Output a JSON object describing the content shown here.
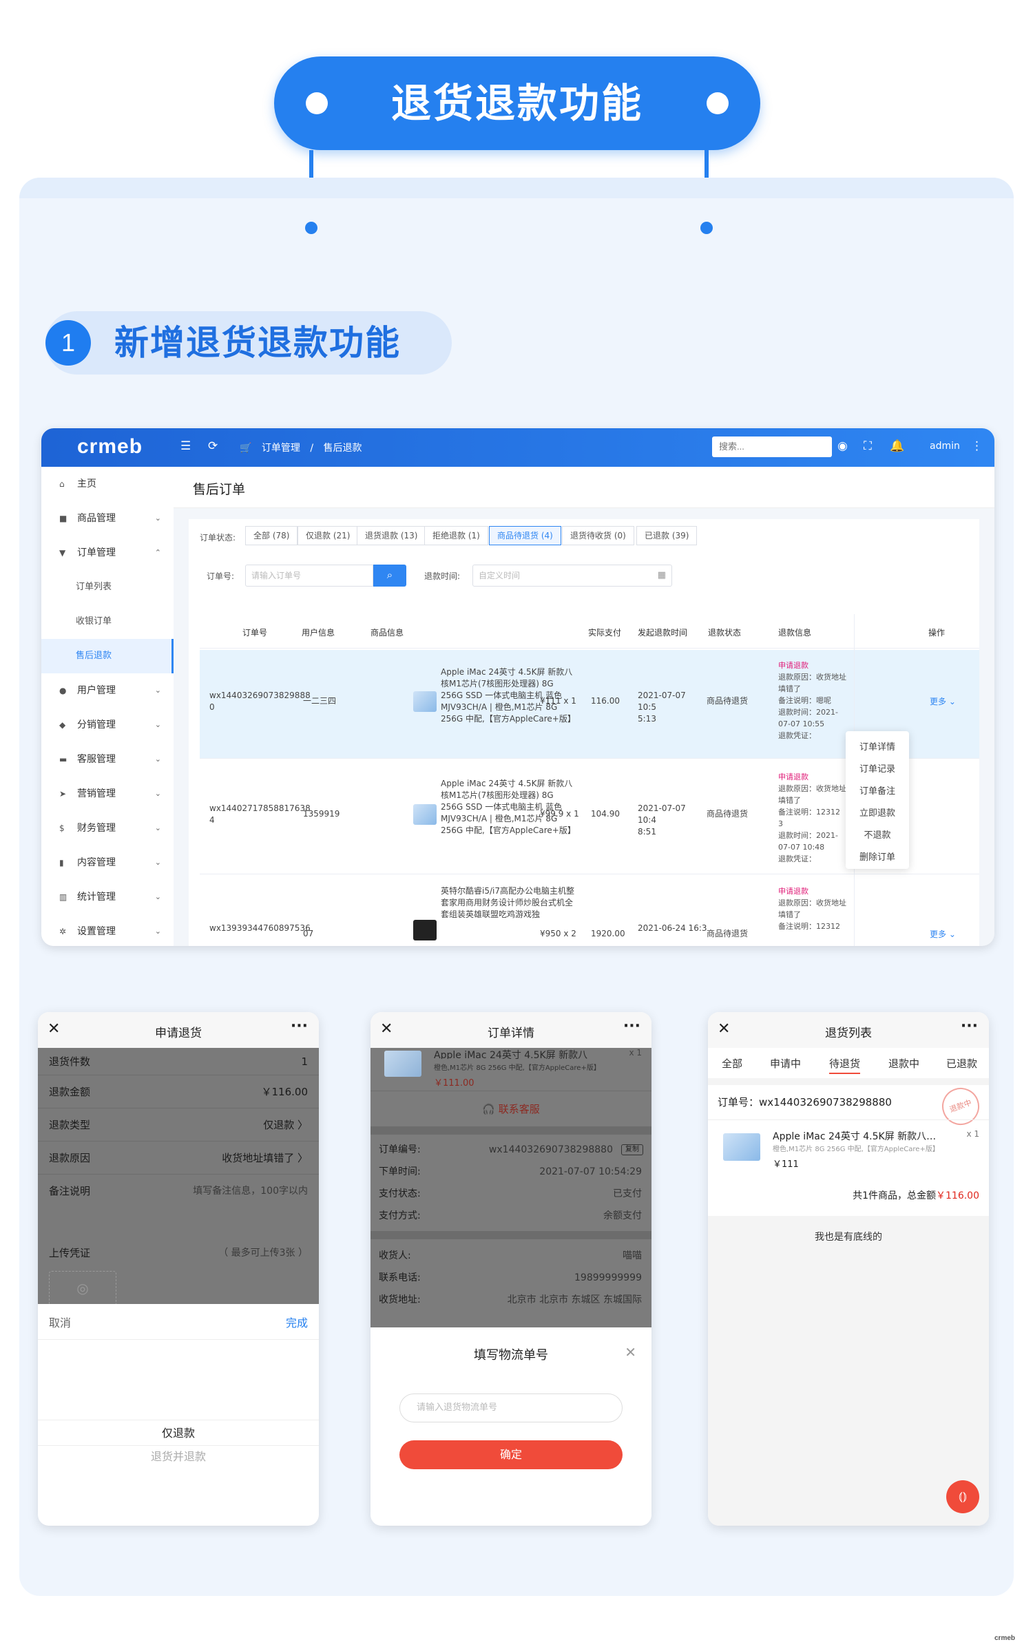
{
  "hero": {
    "title": "退货退款功能"
  },
  "section": {
    "number": "1",
    "title": "新增退货退款功能"
  },
  "admin": {
    "logo": "crmeb",
    "breadcrumb": [
      "订单管理",
      "/",
      "售后退款"
    ],
    "search_placeholder": "搜索...",
    "user": "admin",
    "sidebar": [
      {
        "label": "主页",
        "icon": "home-icon",
        "arrow": ""
      },
      {
        "label": "商品管理",
        "icon": "shop-icon",
        "arrow": "⌄"
      },
      {
        "label": "订单管理",
        "icon": "cart-icon",
        "arrow": "⌃"
      },
      {
        "label": "用户管理",
        "icon": "user-icon",
        "arrow": "⌄"
      },
      {
        "label": "分销管理",
        "icon": "share-icon",
        "arrow": "⌄"
      },
      {
        "label": "客服管理",
        "icon": "chat-icon",
        "arrow": "⌄"
      },
      {
        "label": "营销管理",
        "icon": "send-icon",
        "arrow": "⌄"
      },
      {
        "label": "财务管理",
        "icon": "dollar-icon",
        "arrow": "⌄"
      },
      {
        "label": "内容管理",
        "icon": "book-icon",
        "arrow": "⌄"
      },
      {
        "label": "统计管理",
        "icon": "bar-chart-icon",
        "arrow": "⌄"
      },
      {
        "label": "设置管理",
        "icon": "gear-icon",
        "arrow": "⌄"
      }
    ],
    "sub_items": [
      "订单列表",
      "收银订单",
      "售后退款"
    ],
    "page_title": "售后订单",
    "status_label": "订单状态:",
    "status_tabs": [
      "全部 (78)",
      "仅退款 (21)",
      "退货退款 (13)",
      "拒绝退款 (1)",
      "商品待退货 (4)",
      "退货待收货 (0)",
      "已退款 (39)"
    ],
    "order_label": "订单号:",
    "order_placeholder": "请输入订单号",
    "date_label": "退款时间:",
    "date_placeholder": "自定义时间",
    "columns": [
      "订单号",
      "用户信息",
      "商品信息",
      "实际支付",
      "发起退款时间",
      "退款状态",
      "退款信息",
      "操作"
    ],
    "rows": [
      {
        "order_no": "wx14403269073829888\n0",
        "user": "一二三四",
        "product": "Apple iMac 24英寸 4.5K屏 新款八核M1芯片(7核图形处理器) 8G 256G SSD 一体式电脑主机 蓝色 MJV93CH/A | 橙色,M1芯片 8G 256G 中配,【官方AppleCare+版】",
        "qty": "¥111 x 1",
        "paid": "116.00",
        "time": "2021-07-07 10:5\n5:13",
        "status": "商品待退货",
        "refund_state": "申请退款",
        "refund_info": "退款原因：收货地址填错了\n备注说明：嗯呢\n退款时间：2021-07-07 10:55\n退款凭证：",
        "more": "更多 ⌄"
      },
      {
        "order_no": "wx14402717858817638\n4",
        "user": "1359919",
        "product": "Apple iMac 24英寸 4.5K屏 新款八核M1芯片(7核图形处理器) 8G 256G SSD 一体式电脑主机 蓝色 MJV93CH/A | 橙色,M1芯片 8G 256G 中配,【官方AppleCare+版】",
        "qty": "¥99.9 x 1",
        "paid": "104.90",
        "time": "2021-07-07 10:4\n8:51",
        "status": "商品待退货",
        "refund_state": "申请退款",
        "refund_info": "退款原因：收货地址填错了\n备注说明：12312\n3\n退款时间：2021-07-07 10:48\n退款凭证：",
        "more": ""
      },
      {
        "order_no": "wx13939344760897536",
        "user": "07",
        "product": "英特尔酷睿i5/i7高配办公电脑主机整套家用商用财务设计师炒股台式机全套组装英雄联盟吃鸡游戏独",
        "qty": "¥950 x 2",
        "paid": "1920.00",
        "time": "2021-06-24 16:3",
        "status": "商品待退货",
        "refund_state": "申请退款",
        "refund_info": "退款原因：收货地址填错了\n备注说明：12312",
        "more": "更多 ⌄"
      }
    ],
    "dropdown": [
      "订单详情",
      "订单记录",
      "订单备注",
      "立即退款",
      "不退款",
      "删除订单"
    ]
  },
  "phone1": {
    "title": "申请退货",
    "fields": [
      {
        "k": "退货件数",
        "v": "1"
      },
      {
        "k": "退款金额",
        "v": "￥116.00"
      },
      {
        "k": "退款类型",
        "v": "仅退款  〉"
      },
      {
        "k": "退款原因",
        "v": "收货地址填错了  〉"
      },
      {
        "k": "备注说明",
        "v": "填写备注信息，100字以内"
      }
    ],
    "upload_label": "上传凭证",
    "upload_hint": "（ 最多可上传3张 ）",
    "cancel": "取消",
    "done": "完成",
    "options": [
      "仅退款",
      "退货并退款"
    ]
  },
  "phone2": {
    "title": "订单详情",
    "product_title": "Apple iMac 24英寸 4.5K屏 新款八",
    "product_spec": "橙色,M1芯片 8G 256G 中配,【官方AppleCare+版】",
    "qty": "x 1",
    "price": "￥111.00",
    "service": "联系客服",
    "details": [
      {
        "k": "订单编号:",
        "v": "wx144032690738298880"
      },
      {
        "k": "下单时间:",
        "v": "2021-07-07 10:54:29"
      },
      {
        "k": "支付状态:",
        "v": "已支付"
      },
      {
        "k": "支付方式:",
        "v": "余额支付"
      }
    ],
    "copy": "复制",
    "address": [
      {
        "k": "收货人:",
        "v": "喵喵"
      },
      {
        "k": "联系电话:",
        "v": "19899999999"
      },
      {
        "k": "收货地址:",
        "v": "北京市 北京市 东城区 东城国际"
      }
    ],
    "sheet_title": "填写物流单号",
    "input_placeholder": "请输入退货物流单号",
    "confirm": "确定"
  },
  "phone3": {
    "title": "退货列表",
    "tabs": [
      "全部",
      "申请中",
      "待退货",
      "退款中",
      "已退款"
    ],
    "order_label": "订单号：wx144032690738298880",
    "stamp": "退款中",
    "product_title": "Apple iMac 24英寸 4.5K屏 新款八…",
    "product_spec": "橙色,M1芯片 8G 256G 中配,【官方AppleCare+版】",
    "qty": "x 1",
    "price": "￥111",
    "summary": "共1件商品，总金额",
    "total": "￥116.00",
    "bottom": "我也是有底线的"
  },
  "footer_logo": "crmeb",
  "colors": {
    "brand": "#2580ef",
    "accent_red": "#f04b3a",
    "refund_pink": "#e0207a"
  }
}
